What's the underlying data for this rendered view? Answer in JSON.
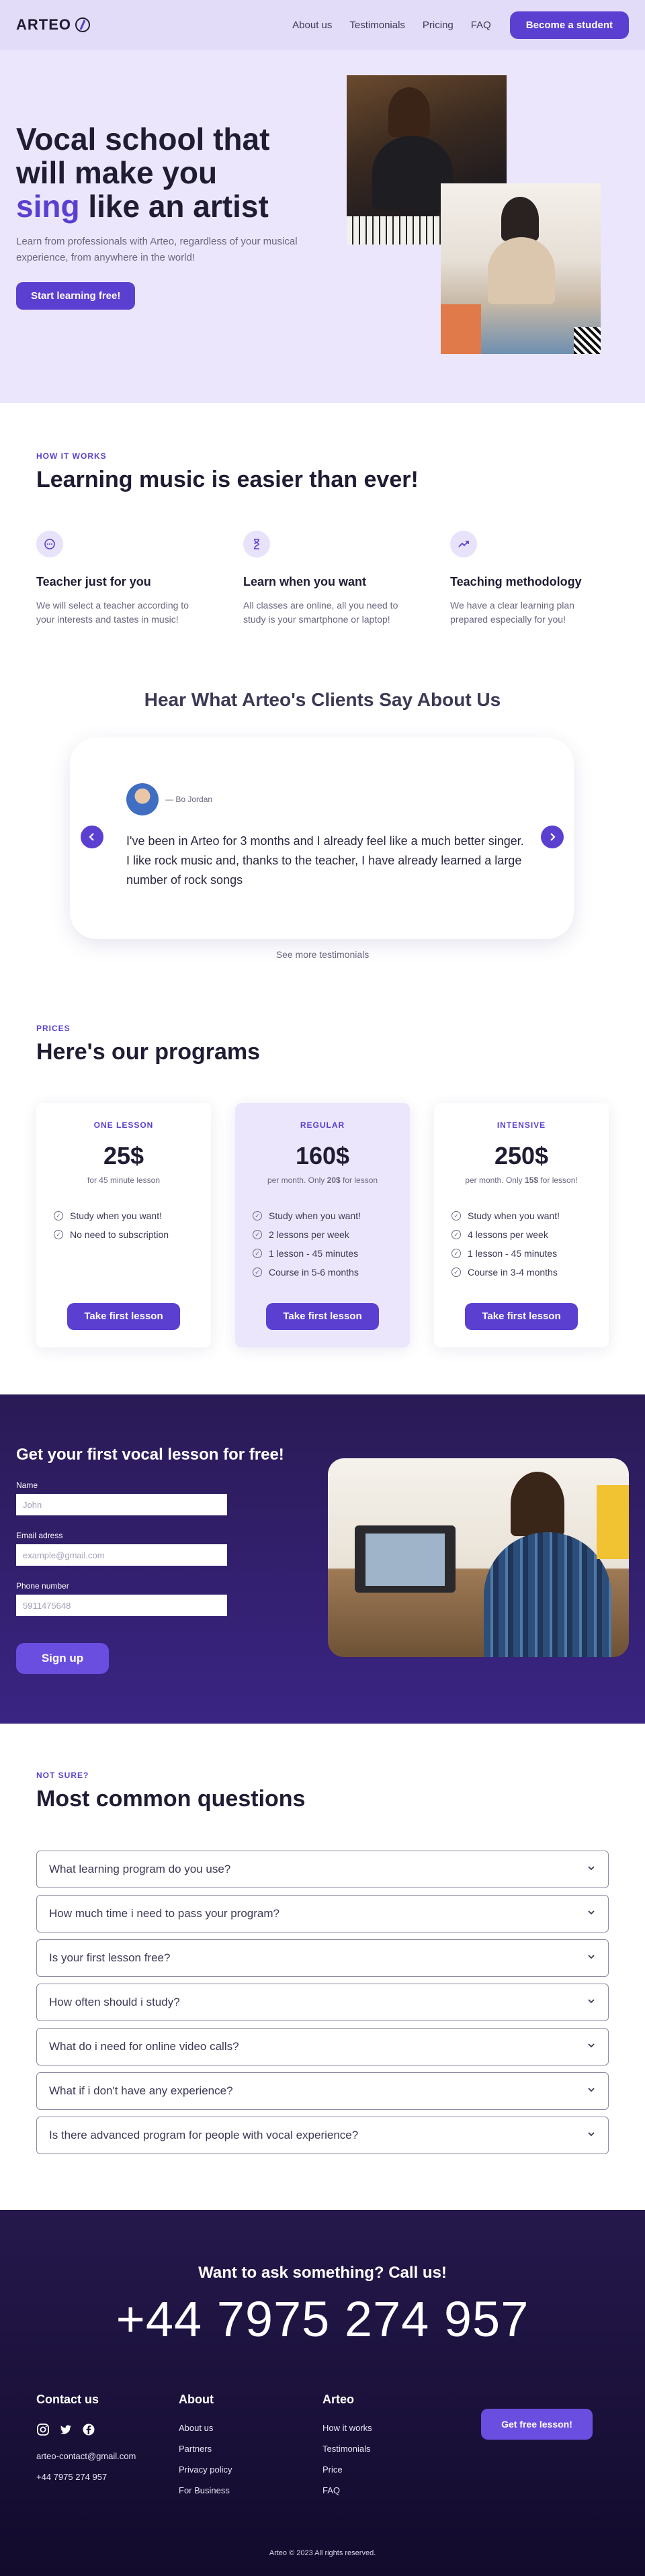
{
  "nav": {
    "logo": "ARTEO",
    "links": [
      "About us",
      "Testimonials",
      "Pricing",
      "FAQ"
    ],
    "cta": "Become a student"
  },
  "hero": {
    "title_line1": "Vocal school that",
    "title_line2": "will make you",
    "title_accent": "sing",
    "title_rest": " like an artist",
    "subtitle": "Learn from professionals with Arteo, regardless of your musical experience, from anywhere in the world!",
    "cta": "Start learning free!"
  },
  "how": {
    "eyebrow": "HOW IT WORKS",
    "title": "Learning music is easier than ever!",
    "features": [
      {
        "icon": "chat-icon",
        "title": "Teacher just for you",
        "text": "We will select a teacher according to your interests and tastes in music!"
      },
      {
        "icon": "hourglass-icon",
        "title": "Learn when you want",
        "text": "All classes are online, all you need to study is your smartphone or laptop!"
      },
      {
        "icon": "trend-icon",
        "title": "Teaching methodology",
        "text": "We have a clear learning plan prepared especially for you!"
      }
    ]
  },
  "testimonials": {
    "title": "Hear What Arteo's Clients Say About Us",
    "author": "— Bo Jordan",
    "quote": "I've been in Arteo for 3 months and I already feel like a much better singer. I like rock music and, thanks to the teacher, I have already learned a large number of rock songs",
    "see_more": "See more testimonials"
  },
  "prices": {
    "eyebrow": "PRICES",
    "title": "Here's our programs",
    "plans": [
      {
        "name": "ONE LESSON",
        "price": "25$",
        "note_pre": "for 45 minute lesson",
        "note_bold": "",
        "note_post": "",
        "features": [
          "Study when you want!",
          "No need to subscription"
        ],
        "cta": "Take first lesson"
      },
      {
        "name": "REGULAR",
        "price": "160$",
        "note_pre": "per month. Only ",
        "note_bold": "20$",
        "note_post": " for lesson",
        "features": [
          "Study when you want!",
          "2 lessons per week",
          "1 lesson - 45 minutes",
          "Course in 5-6 months"
        ],
        "cta": "Take first lesson"
      },
      {
        "name": "INTENSIVE",
        "price": "250$",
        "note_pre": "per month. Only ",
        "note_bold": "15$",
        "note_post": " for lesson!",
        "features": [
          "Study when you want!",
          "4 lessons per week",
          "1 lesson - 45 minutes",
          "Course in 3-4 months"
        ],
        "cta": "Take first lesson"
      }
    ]
  },
  "signup": {
    "title": "Get your first vocal lesson for free!",
    "fields": [
      {
        "label": "Name",
        "placeholder": "John"
      },
      {
        "label": "Email adress",
        "placeholder": "example@gmail.com"
      },
      {
        "label": "Phone number",
        "placeholder": "5911475648"
      }
    ],
    "cta": "Sign up"
  },
  "faq": {
    "eyebrow": "NOT SURE?",
    "title": "Most common questions",
    "items": [
      "What learning program do you use?",
      "How much time i need to pass your program?",
      "Is your first lesson free?",
      "How often should i study?",
      "What do i need for online video calls?",
      "What if i don't have any experience?",
      "Is there advanced program for people with vocal experience?"
    ]
  },
  "footer": {
    "call_title": "Want to ask something? Call us!",
    "phone_big": "+44 7975 274 957",
    "contact": {
      "title": "Contact us",
      "email": "arteo-contact@gmail.com",
      "phone": "+44 7975 274 957"
    },
    "about": {
      "title": "About",
      "links": [
        "About us",
        "Partners",
        "Privacy policy",
        "For Business"
      ]
    },
    "arteo": {
      "title": "Arteo",
      "links": [
        "How it works",
        "Testimonials",
        "Price",
        "FAQ"
      ]
    },
    "cta": "Get free lesson!",
    "copyright": "Arteo © 2023 All rights reserved."
  },
  "colors": {
    "accent": "#5a3fd0",
    "hero_bg": "#ebe6fb",
    "dark_bg": "#25184c"
  }
}
